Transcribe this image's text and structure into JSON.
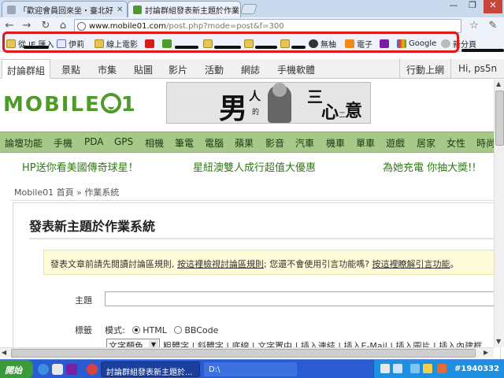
{
  "browser": {
    "tabs": [
      {
        "title": "「歡迎會員回來坐・臺北好",
        "active": false
      },
      {
        "title": "討論群組發表新主題於作業",
        "active": true
      }
    ],
    "url_host": "www.mobile01.com",
    "url_rest": "/post.php?mode=post&f=300",
    "bookmarks": [
      "從 IE 匯入",
      "伊莉",
      "線上電影",
      "無柚",
      "電子",
      "Google",
      "新分頁"
    ]
  },
  "site": {
    "nav": [
      "討論群組",
      "景點",
      "市集",
      "貼圖",
      "影片",
      "活動",
      "網誌",
      "手機軟體"
    ],
    "nav_right": [
      "行動上網",
      "Hi, ps5n"
    ],
    "logo": "MOBILE",
    "banner": {
      "c1": "男",
      "c2": "人",
      "c3": "的",
      "c4": "三",
      "c5": "心",
      "c6": "二",
      "c7": "意"
    },
    "categories": [
      "論壇功能",
      "手機",
      "PDA",
      "GPS",
      "相機",
      "筆電",
      "電腦",
      "蘋果",
      "影音",
      "汽車",
      "機車",
      "單車",
      "遊戲",
      "居家",
      "女性",
      "時尚"
    ],
    "ads": [
      "HP送你看美國傳奇球星！",
      "星紐澳雙人成行超值大優惠",
      "為她充電 你抽大獎!!"
    ],
    "breadcrumb": {
      "home": "Mobile01 首頁",
      "sep": "»",
      "current": "作業系統"
    }
  },
  "post": {
    "title": "發表新主題於作業系統",
    "notice": {
      "t1": "發表文章前請先閱讀討論區規則,",
      "l1": "按這裡檢視討論區規則",
      "t2": "; 您還不會使用引言功能嗎?",
      "l2": "按這裡瞭解引言功能",
      "t3": "。"
    },
    "subject_label": "主題",
    "subject_value": "",
    "tags_label": "標籤",
    "mode_label": "模式:",
    "mode_options": [
      "HTML",
      "BBCode"
    ],
    "mode_selected": "HTML",
    "color_select": "文字顏色",
    "format_links": [
      "粗體字",
      "斜體字",
      "底線",
      "文字置中",
      "插入連結",
      "插入E-Mail",
      "插入圖片",
      "插入內建框"
    ]
  },
  "taskbar": {
    "start": "開始",
    "tasks": [
      "討論群組發表新主題於...",
      "D:\\"
    ],
    "clock": "#1940332"
  },
  "colors": {
    "accent_green": "#4e9a2a",
    "catbar": "#a6c98a",
    "highlight_red": "#e01818",
    "taskbar_blue": "#2a5bd1"
  }
}
